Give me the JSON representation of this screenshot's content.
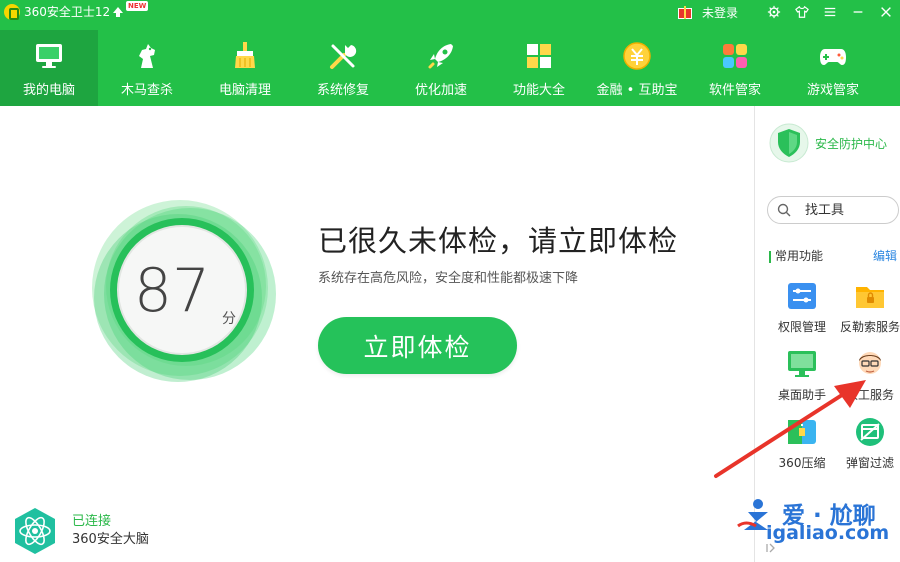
{
  "app": {
    "title": "360安全卫士12",
    "new_badge": "NEW",
    "login_text": "未登录"
  },
  "nav": {
    "items": [
      {
        "label": "我的电脑",
        "icon": "monitor-icon",
        "active": true
      },
      {
        "label": "木马查杀",
        "icon": "horse-icon"
      },
      {
        "label": "电脑清理",
        "icon": "broom-icon"
      },
      {
        "label": "系统修复",
        "icon": "wrench-icon"
      },
      {
        "label": "优化加速",
        "icon": "rocket-icon"
      },
      {
        "label": "功能大全",
        "icon": "grid-icon"
      },
      {
        "label": "金融 • 互助宝",
        "icon": "coin-icon"
      },
      {
        "label": "软件管家",
        "icon": "software-icon"
      },
      {
        "label": "游戏管家",
        "icon": "gamepad-icon"
      }
    ]
  },
  "checkup": {
    "score": "87",
    "unit": "分",
    "headline": "已很久未体检，请立即体检",
    "subline": "系统存在高危风险，安全度和性能都极速下降",
    "button_label": "立即体检"
  },
  "brain": {
    "status": "已连接",
    "name": "360安全大脑"
  },
  "sidebar": {
    "security_center": "安全防护中心",
    "search_placeholder": "找工具",
    "common_title": "常用功能",
    "edit_label": "编辑",
    "tools": [
      {
        "label": "权限管理",
        "icon": "permission-icon"
      },
      {
        "label": "反勒索服务",
        "icon": "folder-lock-icon"
      },
      {
        "label": "桌面助手",
        "icon": "desktop-assistant-icon"
      },
      {
        "label": "人工服务",
        "icon": "support-person-icon"
      },
      {
        "label": "360压缩",
        "icon": "compress-icon"
      },
      {
        "label": "弹窗过滤",
        "icon": "popup-filter-icon"
      }
    ]
  },
  "watermark": {
    "title": "爱 · 尬聊",
    "url": "igaliao.com"
  },
  "colors": {
    "header_green": "#23c048",
    "active_tab_green": "#1ea540",
    "accent_green": "#25c25a",
    "link_blue": "#2a86e0",
    "arrow_red": "#e8342a"
  }
}
